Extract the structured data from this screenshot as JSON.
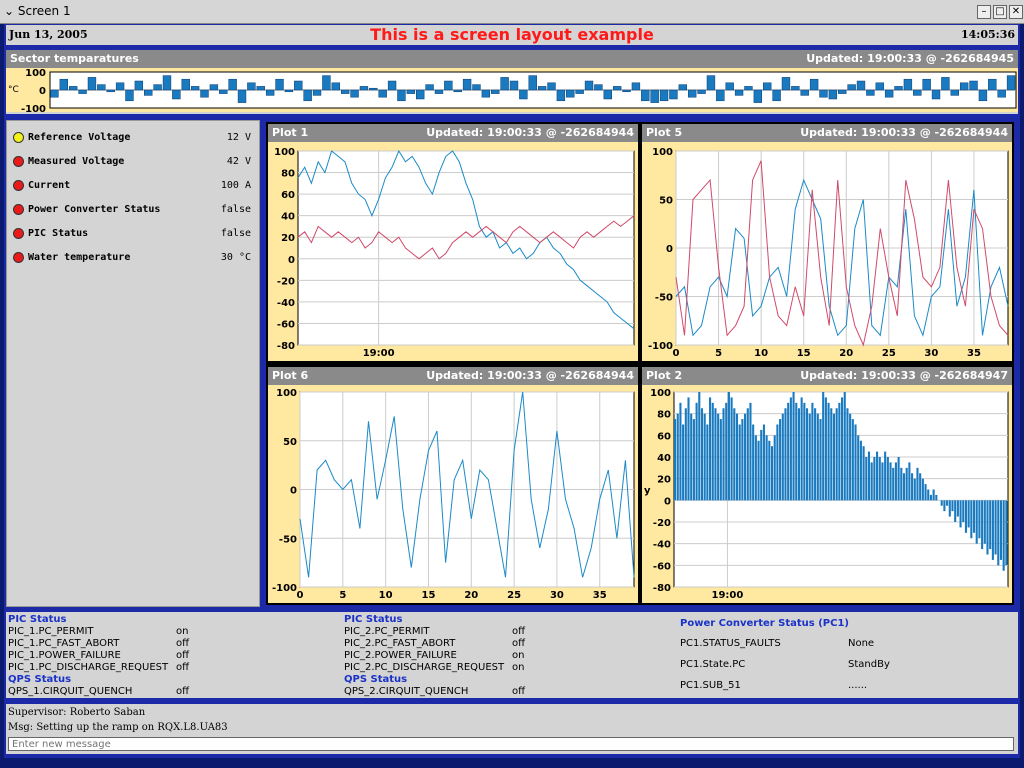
{
  "window": {
    "title": "Screen 1",
    "minimize": "–",
    "maximize": "□",
    "close": "✕"
  },
  "header": {
    "date": "Jun 13, 2005",
    "headline": "This is a screen layout example",
    "time": "14:05:36"
  },
  "sector": {
    "title": "Sector temparatures",
    "updated": "Updated: 19:00:33 @ -262684945",
    "unit": "°C",
    "yticks": [
      "100",
      "0",
      "-100"
    ]
  },
  "status_list": [
    {
      "label": "Reference Voltage",
      "value": "12 V",
      "color": "#f2f21a"
    },
    {
      "label": "Measured Voltage",
      "value": "42 V",
      "color": "#e81a1a"
    },
    {
      "label": "Current",
      "value": "100 A",
      "color": "#e81a1a"
    },
    {
      "label": "Power Converter Status",
      "value": "false",
      "color": "#e81a1a"
    },
    {
      "label": "PIC Status",
      "value": "false",
      "color": "#e81a1a"
    },
    {
      "label": "Water temperature",
      "value": "30 °C",
      "color": "#e81a1a"
    }
  ],
  "plots": {
    "plot1": {
      "title": "Plot 1",
      "updated": "Updated: 19:00:33 @ -262684944"
    },
    "plot5": {
      "title": "Plot 5",
      "updated": "Updated: 19:00:33 @ -262684944"
    },
    "plot6": {
      "title": "Plot 6",
      "updated": "Updated: 19:00:33 @ -262684944"
    },
    "plot2": {
      "title": "Plot 2",
      "updated": "Updated: 19:00:33 @ -262684947",
      "ylabel": "y"
    }
  },
  "chart_data": [
    {
      "id": "sector",
      "type": "bar",
      "ylim": [
        -100,
        100
      ],
      "yticks": [
        100,
        0,
        -100
      ],
      "values": [
        -40,
        60,
        20,
        -20,
        70,
        30,
        -10,
        40,
        -60,
        50,
        -30,
        30,
        80,
        -50,
        60,
        20,
        -40,
        30,
        -20,
        60,
        -70,
        40,
        20,
        -30,
        60,
        -10,
        50,
        -60,
        -30,
        80,
        40,
        -20,
        -40,
        20,
        10,
        -40,
        50,
        -60,
        -20,
        -50,
        30,
        -20,
        50,
        -10,
        60,
        30,
        -40,
        -20,
        70,
        50,
        -50,
        80,
        20,
        40,
        -60,
        -40,
        -20,
        50,
        30,
        -50,
        20,
        -10,
        40,
        -60,
        -70,
        -60,
        -50,
        30,
        -40,
        -20,
        80,
        -60,
        40,
        -30,
        20,
        -70,
        40,
        -60,
        70,
        20,
        -30,
        60,
        -40,
        -50,
        -20,
        30,
        50,
        -30,
        40,
        -40,
        20,
        60,
        -30,
        60,
        -50,
        70,
        -30,
        40,
        50,
        -60,
        60,
        -40,
        80
      ]
    },
    {
      "id": "plot1",
      "type": "line",
      "ylim": [
        -80,
        100
      ],
      "yticks": [
        100,
        80,
        60,
        40,
        20,
        0,
        -20,
        -40,
        -60,
        -80
      ],
      "xticklabels": [
        "19:00"
      ],
      "series": [
        {
          "color": "#1a8ac8",
          "values": [
            75,
            85,
            70,
            90,
            80,
            100,
            95,
            90,
            70,
            60,
            55,
            40,
            55,
            75,
            85,
            100,
            90,
            95,
            85,
            70,
            60,
            80,
            95,
            100,
            90,
            70,
            55,
            30,
            20,
            25,
            10,
            15,
            5,
            10,
            0,
            5,
            15,
            20,
            10,
            5,
            -5,
            -10,
            -20,
            -25,
            -30,
            -35,
            -40,
            -50,
            -55,
            -60,
            -65
          ]
        },
        {
          "color": "#d04a6a",
          "values": [
            20,
            25,
            15,
            30,
            25,
            20,
            25,
            20,
            15,
            20,
            10,
            15,
            25,
            20,
            15,
            20,
            10,
            5,
            0,
            5,
            10,
            0,
            5,
            15,
            20,
            25,
            20,
            25,
            30,
            25,
            20,
            15,
            25,
            30,
            25,
            20,
            15,
            20,
            25,
            20,
            15,
            10,
            20,
            25,
            20,
            25,
            30,
            35,
            30,
            35,
            40
          ]
        }
      ]
    },
    {
      "id": "plot5",
      "type": "line",
      "ylim": [
        -100,
        100
      ],
      "yticks": [
        100,
        50,
        0,
        -50,
        -100
      ],
      "xticks": [
        0,
        5,
        10,
        15,
        20,
        25,
        30,
        35
      ],
      "xlim": [
        0,
        39
      ],
      "series": [
        {
          "color": "#1a8ac8",
          "values": [
            -50,
            -40,
            -90,
            -80,
            -40,
            -30,
            -50,
            20,
            10,
            -70,
            -60,
            -30,
            -20,
            -50,
            40,
            70,
            50,
            30,
            -60,
            -90,
            -80,
            20,
            50,
            -80,
            -90,
            -30,
            -40,
            40,
            -70,
            -90,
            -50,
            -40,
            40,
            -60,
            -30,
            60,
            -90,
            -40,
            -20,
            -60
          ]
        },
        {
          "color": "#d04a6a",
          "values": [
            -30,
            -90,
            50,
            60,
            70,
            -20,
            -90,
            -80,
            -60,
            70,
            90,
            -30,
            -70,
            -80,
            -40,
            -70,
            60,
            -30,
            -80,
            70,
            -40,
            -80,
            -100,
            -60,
            20,
            -30,
            -70,
            70,
            30,
            -30,
            -40,
            -20,
            70,
            -20,
            -60,
            40,
            20,
            -50,
            -80,
            -90
          ]
        }
      ]
    },
    {
      "id": "plot6",
      "type": "line",
      "ylim": [
        -100,
        100
      ],
      "yticks": [
        100,
        50,
        0,
        -50,
        -100
      ],
      "xticks": [
        0,
        5,
        10,
        15,
        20,
        25,
        30,
        35
      ],
      "xlim": [
        0,
        39
      ],
      "series": [
        {
          "color": "#1a8ac8",
          "values": [
            -30,
            -90,
            20,
            30,
            10,
            0,
            10,
            -40,
            70,
            -10,
            30,
            75,
            -20,
            -80,
            -10,
            40,
            60,
            -75,
            10,
            30,
            -30,
            20,
            10,
            -40,
            -90,
            40,
            100,
            -10,
            -60,
            -20,
            60,
            -10,
            -40,
            -90,
            -60,
            -10,
            20,
            -50,
            30,
            -90
          ]
        }
      ]
    },
    {
      "id": "plot2",
      "type": "bar",
      "ylim": [
        -80,
        100
      ],
      "yticks": [
        100,
        80,
        60,
        40,
        20,
        0,
        -20,
        -40,
        -60,
        -80
      ],
      "xticklabels": [
        "19:00"
      ],
      "ylabel": "y",
      "color": "#1a7ac0",
      "values": [
        75,
        80,
        90,
        70,
        85,
        95,
        80,
        75,
        90,
        100,
        85,
        80,
        70,
        95,
        90,
        85,
        80,
        75,
        85,
        90,
        100,
        95,
        85,
        80,
        70,
        75,
        80,
        85,
        90,
        70,
        60,
        55,
        65,
        70,
        60,
        55,
        50,
        60,
        70,
        75,
        80,
        85,
        90,
        95,
        100,
        90,
        85,
        95,
        90,
        85,
        80,
        90,
        85,
        80,
        75,
        100,
        95,
        90,
        85,
        80,
        85,
        90,
        95,
        100,
        85,
        80,
        75,
        70,
        60,
        55,
        50,
        40,
        45,
        35,
        40,
        45,
        40,
        35,
        45,
        40,
        35,
        30,
        35,
        40,
        30,
        25,
        30,
        35,
        25,
        20,
        30,
        25,
        20,
        15,
        10,
        5,
        10,
        5,
        0,
        -5,
        -10,
        -5,
        -15,
        -10,
        -20,
        -15,
        -25,
        -20,
        -30,
        -25,
        -35,
        -30,
        -40,
        -35,
        -45,
        -40,
        -50,
        -45,
        -55,
        -50,
        -60,
        -55,
        -65,
        -60
      ]
    }
  ],
  "pic1": {
    "header": "PIC  Status",
    "rows": [
      {
        "k": "PIC_1.PC_PERMIT",
        "v": "on"
      },
      {
        "k": "PIC_1.PC_FAST_ABORT",
        "v": "off"
      },
      {
        "k": "PIC_1.POWER_FAILURE",
        "v": "off"
      },
      {
        "k": "PIC_1.PC_DISCHARGE_REQUEST",
        "v": "off"
      }
    ],
    "qps_header": "QPS  Status",
    "qps_rows": [
      {
        "k": "QPS_1.CIRQUIT_QUENCH",
        "v": "off"
      }
    ]
  },
  "pic2": {
    "header": "PIC  Status",
    "rows": [
      {
        "k": "PIC_2.PC_PERMIT",
        "v": "off"
      },
      {
        "k": "PIC_2.PC_FAST_ABORT",
        "v": "off"
      },
      {
        "k": "PIC_2.POWER_FAILURE",
        "v": "on"
      },
      {
        "k": "PIC_2.PC_DISCHARGE_REQUEST",
        "v": "on"
      }
    ],
    "qps_header": "QPS  Status",
    "qps_rows": [
      {
        "k": "QPS_2.CIRQUIT_QUENCH",
        "v": "off"
      }
    ]
  },
  "pc1": {
    "header": "Power Converter Status (PC1)",
    "rows": [
      {
        "k": "PC1.STATUS_FAULTS",
        "v": "None"
      },
      {
        "k": "PC1.State.PC",
        "v": "StandBy"
      },
      {
        "k": "PC1.SUB_51",
        "v": "......"
      }
    ]
  },
  "messages": {
    "supervisor": "Supervisor: Roberto Saban",
    "msg": "Msg: Setting up the ramp on RQX.L8.UA83",
    "input_placeholder": "Enter new message"
  }
}
